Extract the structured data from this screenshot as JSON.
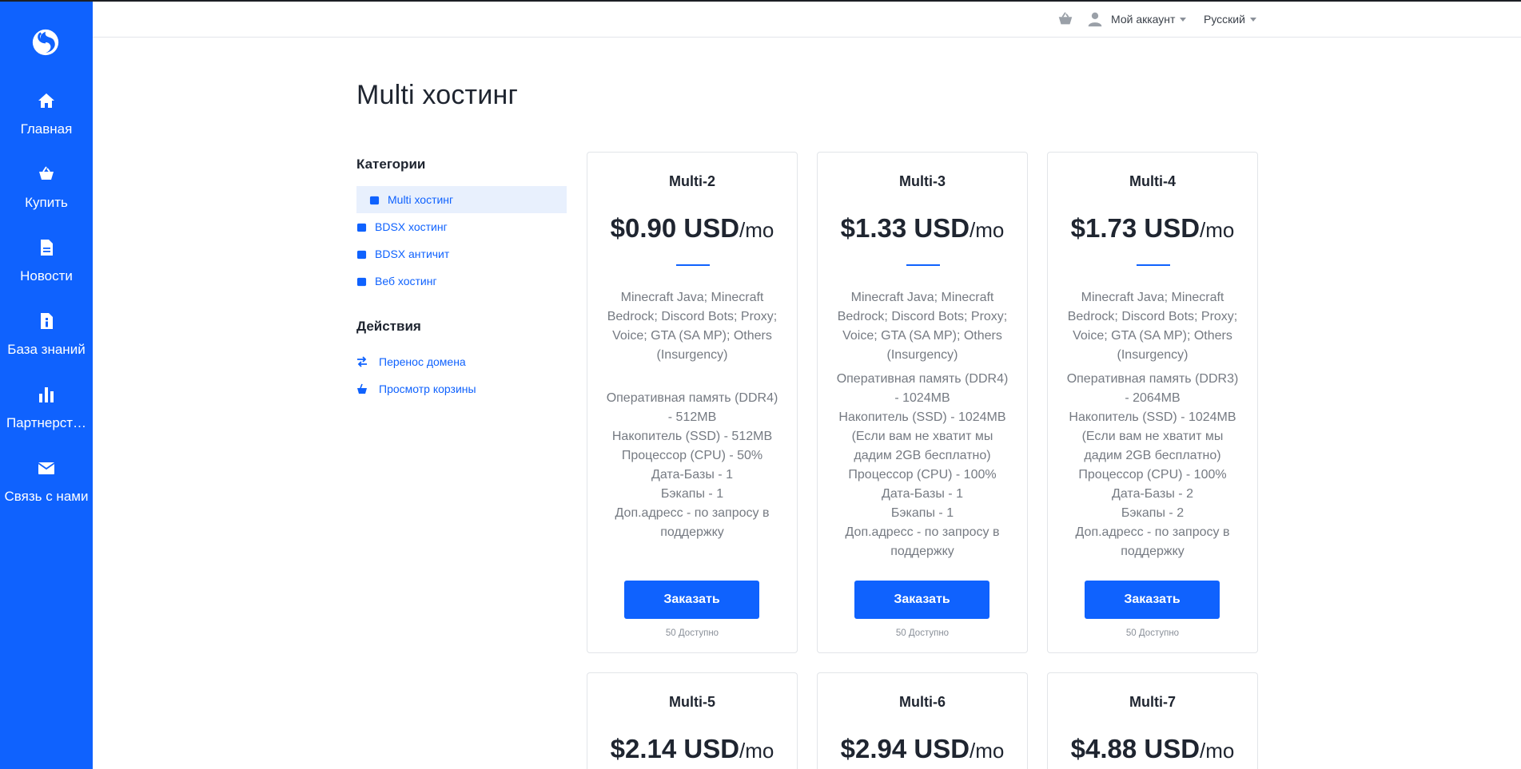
{
  "sidebar": {
    "logo": "swirl-logo",
    "items": [
      {
        "label": "Главная",
        "icon": "home-icon"
      },
      {
        "label": "Купить",
        "icon": "basket-icon"
      },
      {
        "label": "Новости",
        "icon": "news-document-icon"
      },
      {
        "label": "База знаний",
        "icon": "knowledgebase-icon"
      },
      {
        "label": "Партнерст…",
        "icon": "bar-chart-icon"
      },
      {
        "label": "Связь с нами",
        "icon": "envelope-icon"
      }
    ]
  },
  "header": {
    "cart_icon": "basket-icon",
    "account_label": "Мой аккаунт",
    "language_label": "Русский"
  },
  "page_title": "Multi хостинг",
  "categories": {
    "heading": "Категории",
    "items": [
      {
        "label": "Multi хостинг",
        "active": true
      },
      {
        "label": "BDSX хостинг",
        "active": false
      },
      {
        "label": "BDSX античит",
        "active": false
      },
      {
        "label": "Веб хостинг",
        "active": false
      }
    ]
  },
  "actions": {
    "heading": "Действия",
    "items": [
      {
        "label": "Перенос домена",
        "icon": "transfer-arrows-icon"
      },
      {
        "label": "Просмотр корзины",
        "icon": "cart-icon"
      }
    ]
  },
  "products": [
    {
      "name": "Multi-2",
      "price": "$0.90 USD",
      "cycle": "/mo",
      "games": "Minecraft Java; Minecraft Bedrock; Discord Bots; Proxy; Voice; GTA (SA MP); Others (Insurgency)",
      "specs": "Оперативная память (DDR4) - 512MB\nНакопитель (SSD) - 512MB\nПроцессор (CPU) - 50%\nДата-Базы - 1\nБэкапы - 1\nДоп.адресс - по запросу в поддержку",
      "order_label": "Заказать",
      "availability": "50 Доступно"
    },
    {
      "name": "Multi-3",
      "price": "$1.33 USD",
      "cycle": "/mo",
      "games": "Minecraft Java; Minecraft Bedrock; Discord Bots; Proxy; Voice; GTA (SA MP); Others (Insurgency)",
      "specs": "Оперативная память (DDR4) - 1024MB\nНакопитель (SSD) - 1024MB (Если вам не хватит мы дадим 2GB бесплатно)\nПроцессор (CPU) - 100%\nДата-Базы - 1\nБэкапы - 1\nДоп.адресс - по запросу в поддержку",
      "order_label": "Заказать",
      "availability": "50 Доступно"
    },
    {
      "name": "Multi-4",
      "price": "$1.73 USD",
      "cycle": "/mo",
      "games": "Minecraft Java; Minecraft Bedrock; Discord Bots; Proxy; Voice; GTA (SA MP); Others (Insurgency)",
      "specs": "Оперативная память (DDR3) - 2064MB\nНакопитель (SSD) - 1024MB (Если вам не хватит мы дадим 2GB бесплатно)\nПроцессор (CPU) - 100%\nДата-Базы - 2\nБэкапы - 2\nДоп.адресс - по запросу в поддержку",
      "order_label": "Заказать",
      "availability": "50 Доступно"
    },
    {
      "name": "Multi-5",
      "price": "$2.14 USD",
      "cycle": "/mo"
    },
    {
      "name": "Multi-6",
      "price": "$2.94 USD",
      "cycle": "/mo"
    },
    {
      "name": "Multi-7",
      "price": "$4.88 USD",
      "cycle": "/mo"
    }
  ],
  "colors": {
    "brand": "#0f62fe",
    "active_category_bg": "#e8f0fd",
    "muted_text": "#757a82"
  }
}
